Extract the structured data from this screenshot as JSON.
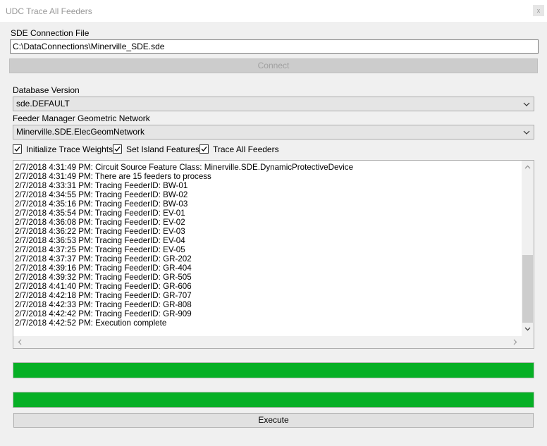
{
  "window": {
    "title": "UDC Trace All Feeders",
    "close_glyph": "x"
  },
  "sde": {
    "label": "SDE Connection File",
    "value": "C:\\DataConnections\\Minerville_SDE.sde",
    "connect_label": "Connect"
  },
  "db_version": {
    "label": "Database Version",
    "selected": "sde.DEFAULT"
  },
  "network": {
    "label": "Feeder Manager Geometric Network",
    "selected": "Minerville.SDE.ElecGeomNetwork"
  },
  "options": [
    {
      "label": "Initialize Trace Weights",
      "checked": true
    },
    {
      "label": "Set Island Features",
      "checked": true
    },
    {
      "label": "Trace All Feeders",
      "checked": true
    }
  ],
  "log": [
    "2/7/2018 4:31:49 PM: Circuit Source Feature Class: Minerville.SDE.DynamicProtectiveDevice",
    "2/7/2018 4:31:49 PM: There are 15 feeders to process",
    "2/7/2018 4:33:31 PM: Tracing FeederID: BW-01",
    "2/7/2018 4:34:55 PM: Tracing FeederID: BW-02",
    "2/7/2018 4:35:16 PM: Tracing FeederID: BW-03",
    "2/7/2018 4:35:54 PM: Tracing FeederID: EV-01",
    "2/7/2018 4:36:08 PM: Tracing FeederID: EV-02",
    "2/7/2018 4:36:22 PM: Tracing FeederID: EV-03",
    "2/7/2018 4:36:53 PM: Tracing FeederID: EV-04",
    "2/7/2018 4:37:25 PM: Tracing FeederID: EV-05",
    "2/7/2018 4:37:37 PM: Tracing FeederID: GR-202",
    "2/7/2018 4:39:16 PM: Tracing FeederID: GR-404",
    "2/7/2018 4:39:32 PM: Tracing FeederID: GR-505",
    "2/7/2018 4:41:40 PM: Tracing FeederID: GR-606",
    "2/7/2018 4:42:18 PM: Tracing FeederID: GR-707",
    "2/7/2018 4:42:33 PM: Tracing FeederID: GR-808",
    "2/7/2018 4:42:42 PM: Tracing FeederID: GR-909",
    "2/7/2018 4:42:52 PM: Execution complete"
  ],
  "progress": [
    {
      "value_percent": 100
    },
    {
      "value_percent": 100
    }
  ],
  "execute_label": "Execute",
  "colors": {
    "progress_fill": "#06b025",
    "window_bg": "#f0f0f0",
    "disabled_button": "#cccccc"
  },
  "icons": {
    "dropdown": "chevron-down-icon",
    "checkbox": "checkmark-icon",
    "scroll_up": "triangle-up-icon",
    "scroll_down": "triangle-down-icon",
    "scroll_left": "triangle-left-icon",
    "scroll_right": "triangle-right-icon"
  }
}
